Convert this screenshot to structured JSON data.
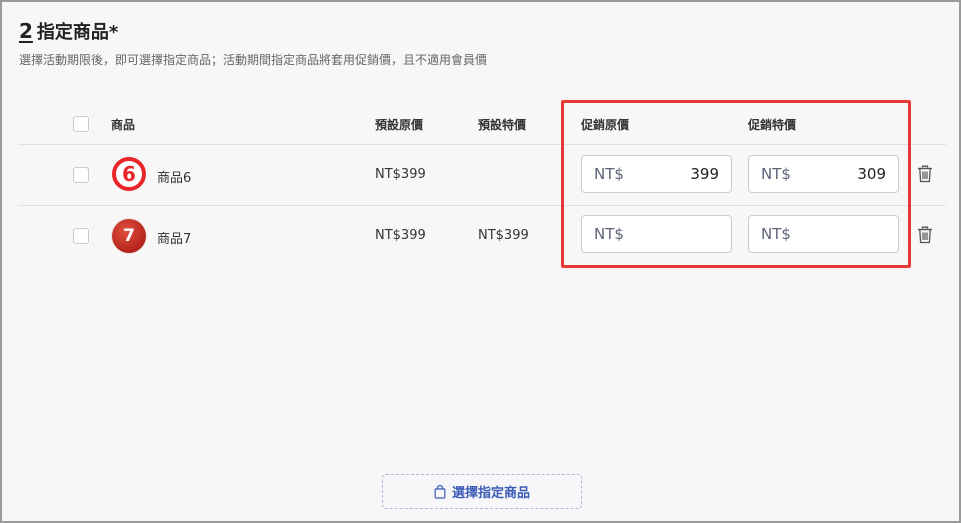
{
  "section": {
    "step": "2",
    "title": "指定商品",
    "required_mark": "*",
    "subtitle": "選擇活動期限後，即可選擇指定商品；活動期間指定商品將套用促銷價，且不適用會員價"
  },
  "table": {
    "headers": {
      "product": "商品",
      "default_original": "預設原價",
      "default_special": "預設特價",
      "promo_original": "促銷原價",
      "promo_special": "促銷特價"
    },
    "rows": [
      {
        "thumb_label": "6",
        "name": "商品6",
        "default_original": "NT$399",
        "default_special": "",
        "promo_original_prefix": "NT$",
        "promo_original_value": "399",
        "promo_special_prefix": "NT$",
        "promo_special_value": "309"
      },
      {
        "thumb_label": "7",
        "name": "商品7",
        "default_original": "NT$399",
        "default_special": "NT$399",
        "promo_original_prefix": "NT$",
        "promo_original_value": "",
        "promo_special_prefix": "NT$",
        "promo_special_value": ""
      }
    ]
  },
  "select_button": {
    "label": "選擇指定商品",
    "icon": "shopping-bag-icon"
  },
  "colors": {
    "highlight": "#e53935",
    "accent": "#3a5bb5",
    "thumb6": "#e8262a",
    "thumb7": "#b4231c"
  }
}
